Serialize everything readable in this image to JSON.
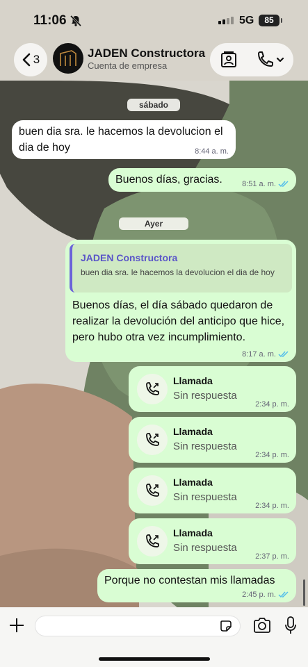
{
  "status_bar": {
    "time": "11:06",
    "network": "5G",
    "battery": "85"
  },
  "header": {
    "back_count": "3",
    "contact_name": "JADEN Constructora",
    "contact_subtitle": "Cuenta de empresa"
  },
  "messages": {
    "date_1": "sábado",
    "m1_text": "buen dia sra. le hacemos la devolucion el dia de hoy",
    "m1_time": "8:44 a. m.",
    "m2_text": "Buenos días, gracias.",
    "m2_time": "8:51 a. m.",
    "date_2": "Ayer",
    "m3_quote_author": "JADEN Constructora",
    "m3_quote_text": "buen dia sra. le hacemos la devolucion el dia de hoy",
    "m3_text": "Buenos días, el día sábado quedaron de realizar la devolución del anticipo que hice, pero hubo otra vez incumplimiento.",
    "m3_time": "8:17 a. m.",
    "calls": [
      {
        "title": "Llamada",
        "status": "Sin respuesta",
        "time": "2:34 p. m."
      },
      {
        "title": "Llamada",
        "status": "Sin respuesta",
        "time": "2:34 p. m."
      },
      {
        "title": "Llamada",
        "status": "Sin respuesta",
        "time": "2:34 p. m."
      },
      {
        "title": "Llamada",
        "status": "Sin respuesta",
        "time": "2:37 p. m."
      }
    ],
    "m4_text": "Porque no contestan mis llamadas",
    "m4_time": "2:45 p. m."
  },
  "colors": {
    "outgoing_bubble": "#d9fdd3",
    "incoming_bubble": "#ffffff",
    "read_tick": "#53bdeb",
    "quote_accent": "#6b63d9"
  },
  "icons": [
    "bell-slash-icon",
    "back-chevron-icon",
    "catalog-icon",
    "phone-icon",
    "chevron-down-icon",
    "missed-call-icon",
    "plus-icon",
    "sticker-icon",
    "camera-icon",
    "mic-icon",
    "double-check-icon"
  ]
}
